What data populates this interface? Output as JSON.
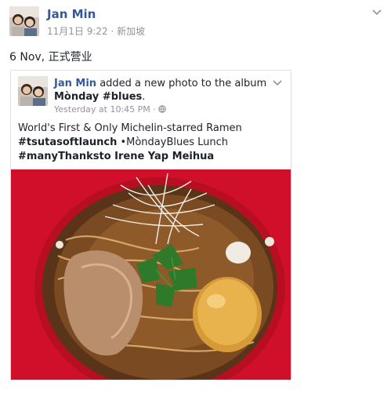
{
  "post": {
    "author": "Jan Min",
    "timestamp": "11月1日 9:22",
    "separator": "·",
    "location": "新加坡",
    "text": "6 Nov, 正式营业"
  },
  "shared": {
    "author": "Jan Min",
    "action": "added a new photo to the album",
    "album": "Mònday #blues",
    "album_end": ".",
    "timestamp": "Yesterday at 10:45 PM",
    "separator": "·",
    "caption_line1": "World's First & Only Michelin-starred Ramen",
    "caption_tag1": "#tsutasoftlaunch",
    "caption_line2_rest": " •MòndayBlues Lunch",
    "caption_tag2": "#manyThanksto Irene Yap Meihua"
  },
  "icons": {
    "chevron": "chevron-down-icon",
    "globe": "globe-icon"
  },
  "colors": {
    "link": "#365899",
    "meta": "#90949c",
    "bowl_red": "#d0102a"
  }
}
